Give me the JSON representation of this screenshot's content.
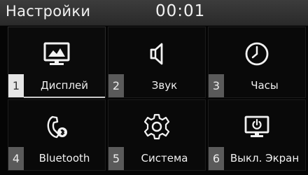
{
  "header": {
    "title": "Настройки",
    "clock": "00:01"
  },
  "tiles": [
    {
      "num": "1",
      "label": "Дисплей",
      "icon": "display-icon",
      "selected": true
    },
    {
      "num": "2",
      "label": "Звук",
      "icon": "speaker-icon"
    },
    {
      "num": "3",
      "label": "Часы",
      "icon": "clock-icon"
    },
    {
      "num": "4",
      "label": "Bluetooth",
      "icon": "bluetooth-phone-icon"
    },
    {
      "num": "5",
      "label": "Система",
      "icon": "gear-icon"
    },
    {
      "num": "6",
      "label": "Выкл. Экран",
      "icon": "screen-off-icon"
    }
  ]
}
